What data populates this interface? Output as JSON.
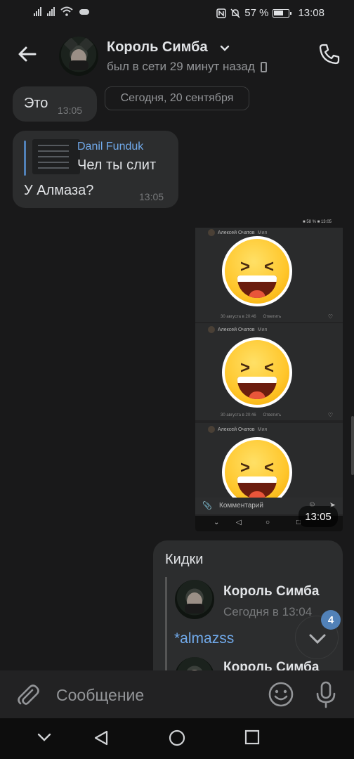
{
  "status_bar": {
    "battery_percent": "57 %",
    "time": "13:08"
  },
  "header": {
    "name": "Король Симба",
    "status": "был в сети 29 минут назад"
  },
  "messages": {
    "m1": {
      "text": "Это",
      "time": "13:05"
    },
    "date_separator": "Сегодня, 20 сентября",
    "m2": {
      "reply_author": "Danil Funduk",
      "reply_text": "Чел ты слит",
      "text": "У Алмаза?",
      "time": "13:05"
    },
    "photo": {
      "time": "13:05",
      "inner_statusbar": "■ 58 % ■ 13:05",
      "posts": [
        {
          "author": "Алексей Очатов",
          "reply_to": "Мия",
          "date": "30 августа в 20:46",
          "action": "Ответить"
        },
        {
          "author": "Алексей Очатов",
          "reply_to": "Мия",
          "date": "30 августа в 20:46",
          "action": "Ответить"
        },
        {
          "author": "Алексей Очатов",
          "reply_to": "Мия"
        }
      ],
      "comment_placeholder": "Комментарий"
    },
    "m3": {
      "text": "Кидки",
      "forwarded": [
        {
          "author": "Король Симба",
          "date": "Сегодня в 13:04",
          "text": "*almazss"
        },
        {
          "author": "Король Симба"
        }
      ]
    }
  },
  "unread_count": "4",
  "composer": {
    "placeholder": "Сообщение"
  },
  "colors": {
    "accent": "#71aaeb",
    "bubble": "#2c2d2e",
    "background": "#19191a",
    "badge": "#5181b8"
  }
}
